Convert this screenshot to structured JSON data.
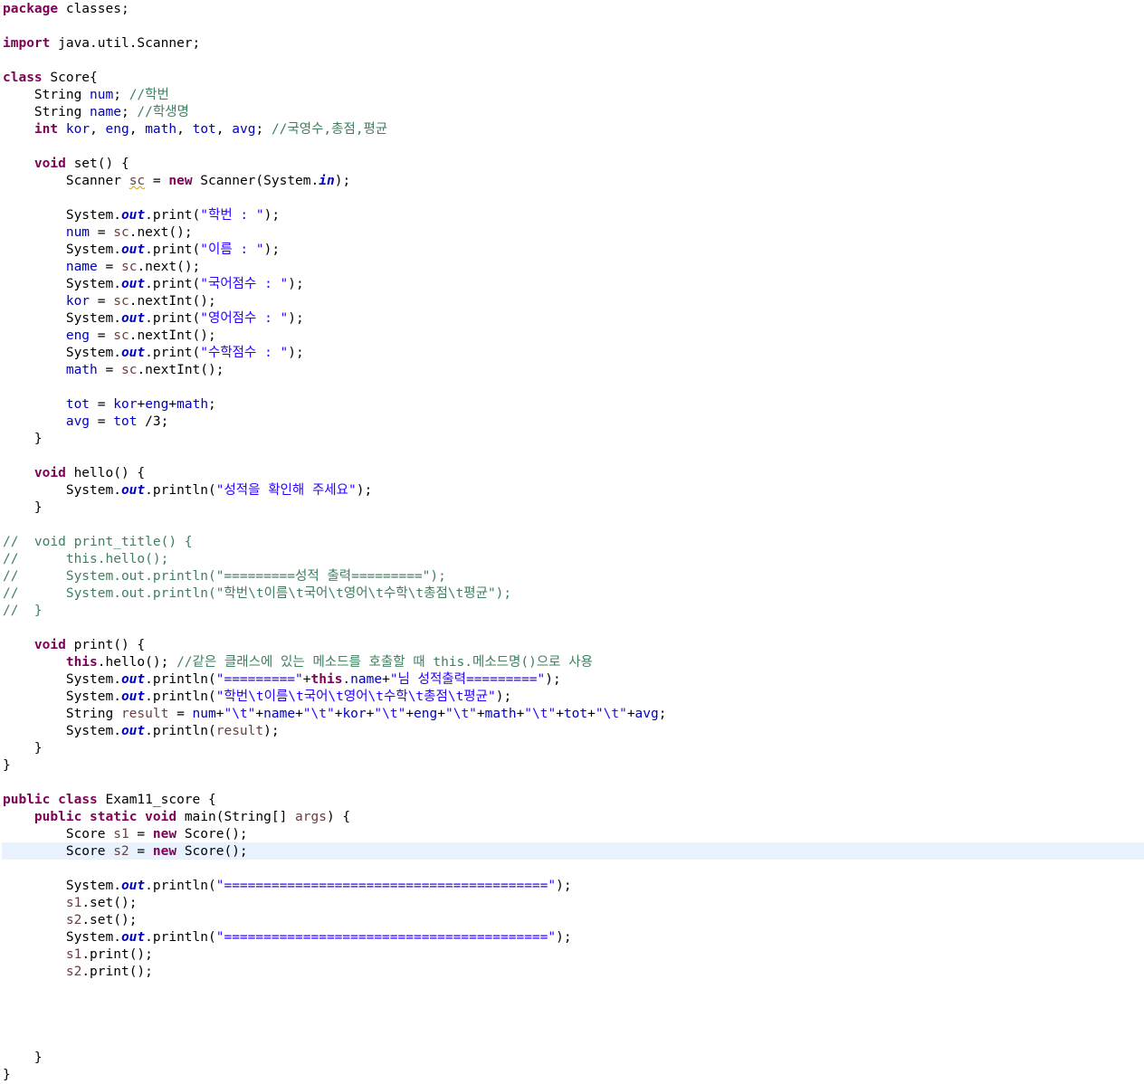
{
  "editor": {
    "current_line": 49,
    "lines": [
      [
        [
          "kw",
          "package"
        ],
        [
          "p",
          " classes;"
        ]
      ],
      [],
      [
        [
          "kw",
          "import"
        ],
        [
          "p",
          " java.util.Scanner;"
        ]
      ],
      [],
      [
        [
          "kw",
          "class"
        ],
        [
          "p",
          " Score{"
        ]
      ],
      [
        [
          "p",
          "    String "
        ],
        [
          "fld",
          "num"
        ],
        [
          "p",
          "; "
        ],
        [
          "cm",
          "//학번"
        ]
      ],
      [
        [
          "p",
          "    String "
        ],
        [
          "fld",
          "name"
        ],
        [
          "p",
          "; "
        ],
        [
          "cm",
          "//학생명"
        ]
      ],
      [
        [
          "p",
          "    "
        ],
        [
          "kw",
          "int"
        ],
        [
          "p",
          " "
        ],
        [
          "fld",
          "kor"
        ],
        [
          "p",
          ", "
        ],
        [
          "fld",
          "eng"
        ],
        [
          "p",
          ", "
        ],
        [
          "fld",
          "math"
        ],
        [
          "p",
          ", "
        ],
        [
          "fld",
          "tot"
        ],
        [
          "p",
          ", "
        ],
        [
          "fld",
          "avg"
        ],
        [
          "p",
          "; "
        ],
        [
          "cm",
          "//국영수,총점,평균"
        ]
      ],
      [],
      [
        [
          "p",
          "    "
        ],
        [
          "kw",
          "void"
        ],
        [
          "p",
          " set() {"
        ]
      ],
      [
        [
          "p",
          "        Scanner "
        ],
        [
          "loc_sq",
          "sc"
        ],
        [
          "p",
          " = "
        ],
        [
          "kw",
          "new"
        ],
        [
          "p",
          " Scanner(System."
        ],
        [
          "st",
          "in"
        ],
        [
          "p",
          ");"
        ]
      ],
      [],
      [
        [
          "p",
          "        System."
        ],
        [
          "st",
          "out"
        ],
        [
          "p",
          ".print("
        ],
        [
          "str",
          "\"학번 : \""
        ],
        [
          "p",
          ");"
        ]
      ],
      [
        [
          "p",
          "        "
        ],
        [
          "fld",
          "num"
        ],
        [
          "p",
          " = "
        ],
        [
          "loc",
          "sc"
        ],
        [
          "p",
          ".next();"
        ]
      ],
      [
        [
          "p",
          "        System."
        ],
        [
          "st",
          "out"
        ],
        [
          "p",
          ".print("
        ],
        [
          "str",
          "\"이름 : \""
        ],
        [
          "p",
          ");"
        ]
      ],
      [
        [
          "p",
          "        "
        ],
        [
          "fld",
          "name"
        ],
        [
          "p",
          " = "
        ],
        [
          "loc",
          "sc"
        ],
        [
          "p",
          ".next();"
        ]
      ],
      [
        [
          "p",
          "        System."
        ],
        [
          "st",
          "out"
        ],
        [
          "p",
          ".print("
        ],
        [
          "str",
          "\"국어점수 : \""
        ],
        [
          "p",
          ");"
        ]
      ],
      [
        [
          "p",
          "        "
        ],
        [
          "fld",
          "kor"
        ],
        [
          "p",
          " = "
        ],
        [
          "loc",
          "sc"
        ],
        [
          "p",
          ".nextInt();"
        ]
      ],
      [
        [
          "p",
          "        System."
        ],
        [
          "st",
          "out"
        ],
        [
          "p",
          ".print("
        ],
        [
          "str",
          "\"영어점수 : \""
        ],
        [
          "p",
          ");"
        ]
      ],
      [
        [
          "p",
          "        "
        ],
        [
          "fld",
          "eng"
        ],
        [
          "p",
          " = "
        ],
        [
          "loc",
          "sc"
        ],
        [
          "p",
          ".nextInt();"
        ]
      ],
      [
        [
          "p",
          "        System."
        ],
        [
          "st",
          "out"
        ],
        [
          "p",
          ".print("
        ],
        [
          "str",
          "\"수학점수 : \""
        ],
        [
          "p",
          ");"
        ]
      ],
      [
        [
          "p",
          "        "
        ],
        [
          "fld",
          "math"
        ],
        [
          "p",
          " = "
        ],
        [
          "loc",
          "sc"
        ],
        [
          "p",
          ".nextInt();"
        ]
      ],
      [],
      [
        [
          "p",
          "        "
        ],
        [
          "fld",
          "tot"
        ],
        [
          "p",
          " = "
        ],
        [
          "fld",
          "kor"
        ],
        [
          "p",
          "+"
        ],
        [
          "fld",
          "eng"
        ],
        [
          "p",
          "+"
        ],
        [
          "fld",
          "math"
        ],
        [
          "p",
          ";"
        ]
      ],
      [
        [
          "p",
          "        "
        ],
        [
          "fld",
          "avg"
        ],
        [
          "p",
          " = "
        ],
        [
          "fld",
          "tot"
        ],
        [
          "p",
          " /3;"
        ]
      ],
      [
        [
          "p",
          "    }"
        ]
      ],
      [],
      [
        [
          "p",
          "    "
        ],
        [
          "kw",
          "void"
        ],
        [
          "p",
          " hello() {"
        ]
      ],
      [
        [
          "p",
          "        System."
        ],
        [
          "st",
          "out"
        ],
        [
          "p",
          ".println("
        ],
        [
          "str",
          "\"성적을 확인해 주세요\""
        ],
        [
          "p",
          ");"
        ]
      ],
      [
        [
          "p",
          "    }"
        ]
      ],
      [],
      [
        [
          "cm",
          "//  void print_title() {"
        ]
      ],
      [
        [
          "cm",
          "//      this.hello();"
        ]
      ],
      [
        [
          "cm",
          "//      System.out.println(\"=========성적 출력=========\");"
        ]
      ],
      [
        [
          "cm",
          "//      System.out.println(\"학번\\t이름\\t국어\\t영어\\t수학\\t총점\\t평균\");"
        ]
      ],
      [
        [
          "cm",
          "//  }"
        ]
      ],
      [],
      [
        [
          "p",
          "    "
        ],
        [
          "kw",
          "void"
        ],
        [
          "p",
          " print() {"
        ]
      ],
      [
        [
          "p",
          "        "
        ],
        [
          "kw",
          "this"
        ],
        [
          "p",
          ".hello(); "
        ],
        [
          "cm",
          "//같은 클래스에 있는 메소드를 호출할 때 this.메소드명()으로 사용"
        ]
      ],
      [
        [
          "p",
          "        System."
        ],
        [
          "st",
          "out"
        ],
        [
          "p",
          ".println("
        ],
        [
          "str",
          "\"=========\""
        ],
        [
          "p",
          "+"
        ],
        [
          "kw",
          "this"
        ],
        [
          "p",
          "."
        ],
        [
          "fld",
          "name"
        ],
        [
          "p",
          "+"
        ],
        [
          "str",
          "\"님 성적출력=========\""
        ],
        [
          "p",
          ");"
        ]
      ],
      [
        [
          "p",
          "        System."
        ],
        [
          "st",
          "out"
        ],
        [
          "p",
          ".println("
        ],
        [
          "str",
          "\"학번\\t이름\\t국어\\t영어\\t수학\\t총점\\t평균\""
        ],
        [
          "p",
          ");"
        ]
      ],
      [
        [
          "p",
          "        String "
        ],
        [
          "loc",
          "result"
        ],
        [
          "p",
          " = "
        ],
        [
          "fld",
          "num"
        ],
        [
          "p",
          "+"
        ],
        [
          "str",
          "\"\\t\""
        ],
        [
          "p",
          "+"
        ],
        [
          "fld",
          "name"
        ],
        [
          "p",
          "+"
        ],
        [
          "str",
          "\"\\t\""
        ],
        [
          "p",
          "+"
        ],
        [
          "fld",
          "kor"
        ],
        [
          "p",
          "+"
        ],
        [
          "str",
          "\"\\t\""
        ],
        [
          "p",
          "+"
        ],
        [
          "fld",
          "eng"
        ],
        [
          "p",
          "+"
        ],
        [
          "str",
          "\"\\t\""
        ],
        [
          "p",
          "+"
        ],
        [
          "fld",
          "math"
        ],
        [
          "p",
          "+"
        ],
        [
          "str",
          "\"\\t\""
        ],
        [
          "p",
          "+"
        ],
        [
          "fld",
          "tot"
        ],
        [
          "p",
          "+"
        ],
        [
          "str",
          "\"\\t\""
        ],
        [
          "p",
          "+"
        ],
        [
          "fld",
          "avg"
        ],
        [
          "p",
          ";"
        ]
      ],
      [
        [
          "p",
          "        System."
        ],
        [
          "st",
          "out"
        ],
        [
          "p",
          ".println("
        ],
        [
          "loc",
          "result"
        ],
        [
          "p",
          ");"
        ]
      ],
      [
        [
          "p",
          "    }"
        ]
      ],
      [
        [
          "p",
          "}"
        ]
      ],
      [],
      [
        [
          "kw",
          "public"
        ],
        [
          "p",
          " "
        ],
        [
          "kw",
          "class"
        ],
        [
          "p",
          " Exam11_score {"
        ]
      ],
      [
        [
          "p",
          "    "
        ],
        [
          "kw",
          "public"
        ],
        [
          "p",
          " "
        ],
        [
          "kw",
          "static"
        ],
        [
          "p",
          " "
        ],
        [
          "kw",
          "void"
        ],
        [
          "p",
          " main(String[] "
        ],
        [
          "loc",
          "args"
        ],
        [
          "p",
          ") {"
        ]
      ],
      [
        [
          "p",
          "        Score "
        ],
        [
          "loc",
          "s1"
        ],
        [
          "p",
          " = "
        ],
        [
          "kw",
          "new"
        ],
        [
          "p",
          " Score();"
        ]
      ],
      [
        [
          "p",
          "        Score "
        ],
        [
          "loc",
          "s2"
        ],
        [
          "p",
          " = "
        ],
        [
          "kw",
          "new"
        ],
        [
          "p",
          " Score();"
        ]
      ],
      [],
      [
        [
          "p",
          "        System."
        ],
        [
          "st",
          "out"
        ],
        [
          "p",
          ".println("
        ],
        [
          "str",
          "\"=========================================\""
        ],
        [
          "p",
          ");"
        ]
      ],
      [
        [
          "p",
          "        "
        ],
        [
          "loc",
          "s1"
        ],
        [
          "p",
          ".set();"
        ]
      ],
      [
        [
          "p",
          "        "
        ],
        [
          "loc",
          "s2"
        ],
        [
          "p",
          ".set();"
        ]
      ],
      [
        [
          "p",
          "        System."
        ],
        [
          "st",
          "out"
        ],
        [
          "p",
          ".println("
        ],
        [
          "str",
          "\"=========================================\""
        ],
        [
          "p",
          ");"
        ]
      ],
      [
        [
          "p",
          "        "
        ],
        [
          "loc",
          "s1"
        ],
        [
          "p",
          ".print();"
        ]
      ],
      [
        [
          "p",
          "        "
        ],
        [
          "loc",
          "s2"
        ],
        [
          "p",
          ".print();"
        ]
      ],
      [],
      [],
      [],
      [],
      [
        [
          "p",
          "    }"
        ]
      ],
      [
        [
          "p",
          "}"
        ]
      ]
    ]
  }
}
